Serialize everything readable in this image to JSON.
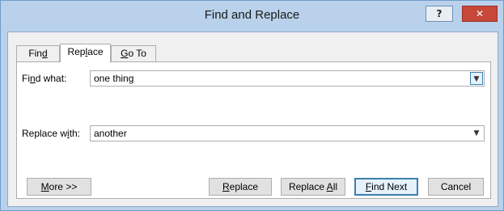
{
  "window": {
    "title": "Find and Replace",
    "help_label": "?",
    "close_label": "✕"
  },
  "tabs": [
    {
      "pre": "Fin",
      "key": "d",
      "post": "",
      "active": false
    },
    {
      "pre": "Rep",
      "key": "l",
      "post": "ace",
      "active": true
    },
    {
      "pre": "",
      "key": "G",
      "post": "o To",
      "active": false
    }
  ],
  "find": {
    "label_pre": "Fi",
    "label_key": "n",
    "label_post": "d what:",
    "value": "one thing",
    "dropdown_icon": "chevron-down-icon"
  },
  "replace": {
    "label_pre": "Replace w",
    "label_key": "i",
    "label_post": "th:",
    "value": "another",
    "dropdown_icon": "chevron-down-icon"
  },
  "buttons": {
    "more": {
      "pre": "",
      "key": "M",
      "post": "ore >>"
    },
    "replace": {
      "pre": "",
      "key": "R",
      "post": "eplace"
    },
    "replace_all": {
      "pre": "Replace ",
      "key": "A",
      "post": "ll"
    },
    "find_next": {
      "pre": "",
      "key": "F",
      "post": "ind Next"
    },
    "cancel": {
      "label": "Cancel"
    }
  },
  "colors": {
    "frame": "#b9d1ea",
    "close_button": "#c7473b",
    "focus_accent": "#3c7fb1"
  }
}
